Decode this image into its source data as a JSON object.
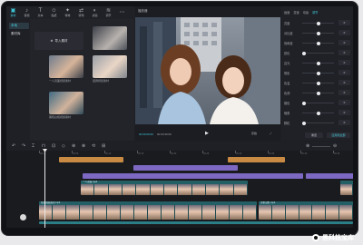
{
  "media": {
    "toolbar": [
      {
        "label": "素材",
        "glyph": "▣",
        "active": true
      },
      {
        "label": "音频",
        "glyph": "♪",
        "active": false
      },
      {
        "label": "文本",
        "glyph": "T",
        "active": false
      },
      {
        "label": "贴纸",
        "glyph": "☺",
        "active": false
      },
      {
        "label": "特效",
        "glyph": "✦",
        "active": false
      },
      {
        "label": "转场",
        "glyph": "⇄",
        "active": false
      },
      {
        "label": "滤镜",
        "glyph": "◐",
        "active": false
      },
      {
        "label": "调节",
        "glyph": "≋",
        "active": false
      },
      {
        "label": "",
        "glyph": "⋯",
        "active": false
      }
    ],
    "side": [
      {
        "label": "本地",
        "active": true
      },
      {
        "label": "素材库",
        "active": false
      }
    ],
    "import_label": "导入素材",
    "thumbs": [
      {
        "caption": "",
        "colors": [
          "#4a4e57",
          "#c9c3bf"
        ]
      },
      {
        "caption": "一人双面视频素材",
        "colors": [
          "#6d7b8e",
          "#d7b59a"
        ]
      },
      {
        "caption": "竖屏视频素材",
        "colors": [
          "#8a8f98",
          "#e8d3c2"
        ]
      },
      {
        "caption": "黑框白框视频素材",
        "colors": [
          "#3f6a83",
          "#d1b39c"
        ]
      }
    ]
  },
  "player": {
    "title": "播放器",
    "timecode_current": "00:00:00:00",
    "timecode_total": "00:00:30:00",
    "play_glyph": "▶",
    "ratio_label": "原始",
    "fullscreen_glyph": "⤢"
  },
  "adjust": {
    "tabs": [
      {
        "label": "画面",
        "active": false
      },
      {
        "label": "变速",
        "active": false
      },
      {
        "label": "动画",
        "active": false
      },
      {
        "label": "调节",
        "active": true
      }
    ],
    "rows": [
      {
        "label": "亮度",
        "value": "0",
        "level": 0.5
      },
      {
        "label": "对比度",
        "value": "0",
        "level": 0.5
      },
      {
        "label": "饱和度",
        "value": "0",
        "level": 0.5
      },
      {
        "label": "锐化",
        "value": "0",
        "level": 0.05
      },
      {
        "label": "高光",
        "value": "0",
        "level": 0.5
      },
      {
        "label": "阴影",
        "value": "0",
        "level": 0.5
      },
      {
        "label": "色温",
        "value": "0",
        "level": 0.5
      },
      {
        "label": "色调",
        "value": "0",
        "level": 0.5
      },
      {
        "label": "褪色",
        "value": "0",
        "level": 0.05
      },
      {
        "label": "暗角",
        "value": "0",
        "level": 0.5
      },
      {
        "label": "颗粒",
        "value": "0",
        "level": 0.05
      }
    ],
    "reset_label": "重置",
    "apply_label": "应用到全部"
  },
  "timeline": {
    "tools": [
      "↶",
      "↷",
      "⌶",
      "⊓",
      "⊡",
      "◇",
      "⊕",
      "⊗",
      "⟲",
      "⊞"
    ],
    "zoom_tools": [
      "⊕",
      "⊖"
    ],
    "ruler": [
      "00:00",
      "00:05",
      "00:10",
      "00:15",
      "00:20",
      "00:25",
      "00:30",
      "00:35",
      "00:40",
      "00:45"
    ],
    "segments": [
      {
        "label": "",
        "color": "orange"
      },
      {
        "label": "",
        "color": "orange"
      },
      {
        "label": "",
        "color": "purple"
      },
      {
        "label": "",
        "color": "purple"
      },
      {
        "label": "",
        "color": "purple"
      }
    ],
    "clips": [
      {
        "label": "一人双面.mp4"
      },
      {
        "label": "竖屏视频素材.mp4"
      },
      {
        "label": ""
      },
      {
        "label": "黑框白框.mp4"
      },
      {
        "label": "竖屏视频素材.mp4"
      }
    ]
  },
  "watermark": {
    "text": "黑科技宝库"
  }
}
